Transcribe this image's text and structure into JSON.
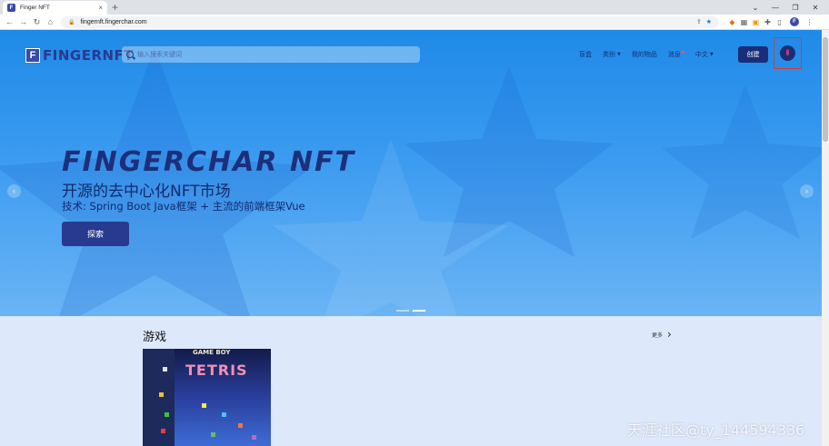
{
  "browser": {
    "tab_title": "Finger NFT",
    "tab_close": "×",
    "new_tab": "+",
    "url": "fingernft.fingerchar.com",
    "profile_initial": "F",
    "window_controls": [
      "⌄",
      "—",
      "❐",
      "✕"
    ]
  },
  "header": {
    "logo_mark": "F",
    "logo_text": "FINGERNFT",
    "search_placeholder": "输入搜索关键词",
    "nav": [
      {
        "label": "盲盒"
      },
      {
        "label": "类别"
      },
      {
        "label": "我的物品"
      },
      {
        "label": "消息"
      },
      {
        "label": "中文"
      }
    ],
    "create_label": "创建"
  },
  "hero": {
    "title": "FINGERCHAR NFT",
    "subtitle": "开源的去中心化NFT市场",
    "tech_line": "技术: Spring Boot Java框架 + 主流的前端框架Vue",
    "explore_label": "探索"
  },
  "section": {
    "title": "游戏",
    "more_label": "更多"
  },
  "card": {
    "cover_label": "GAME BOY",
    "cover_title": "TETRIS"
  },
  "watermark": "天涯社区@ty_144594336",
  "colors": {
    "brand": "#1a2e78",
    "hero_top": "#1f8ae8",
    "hero_bottom": "#6ab4f5",
    "page_bg": "#dde8fb",
    "highlight_box": "#d63a3a"
  }
}
